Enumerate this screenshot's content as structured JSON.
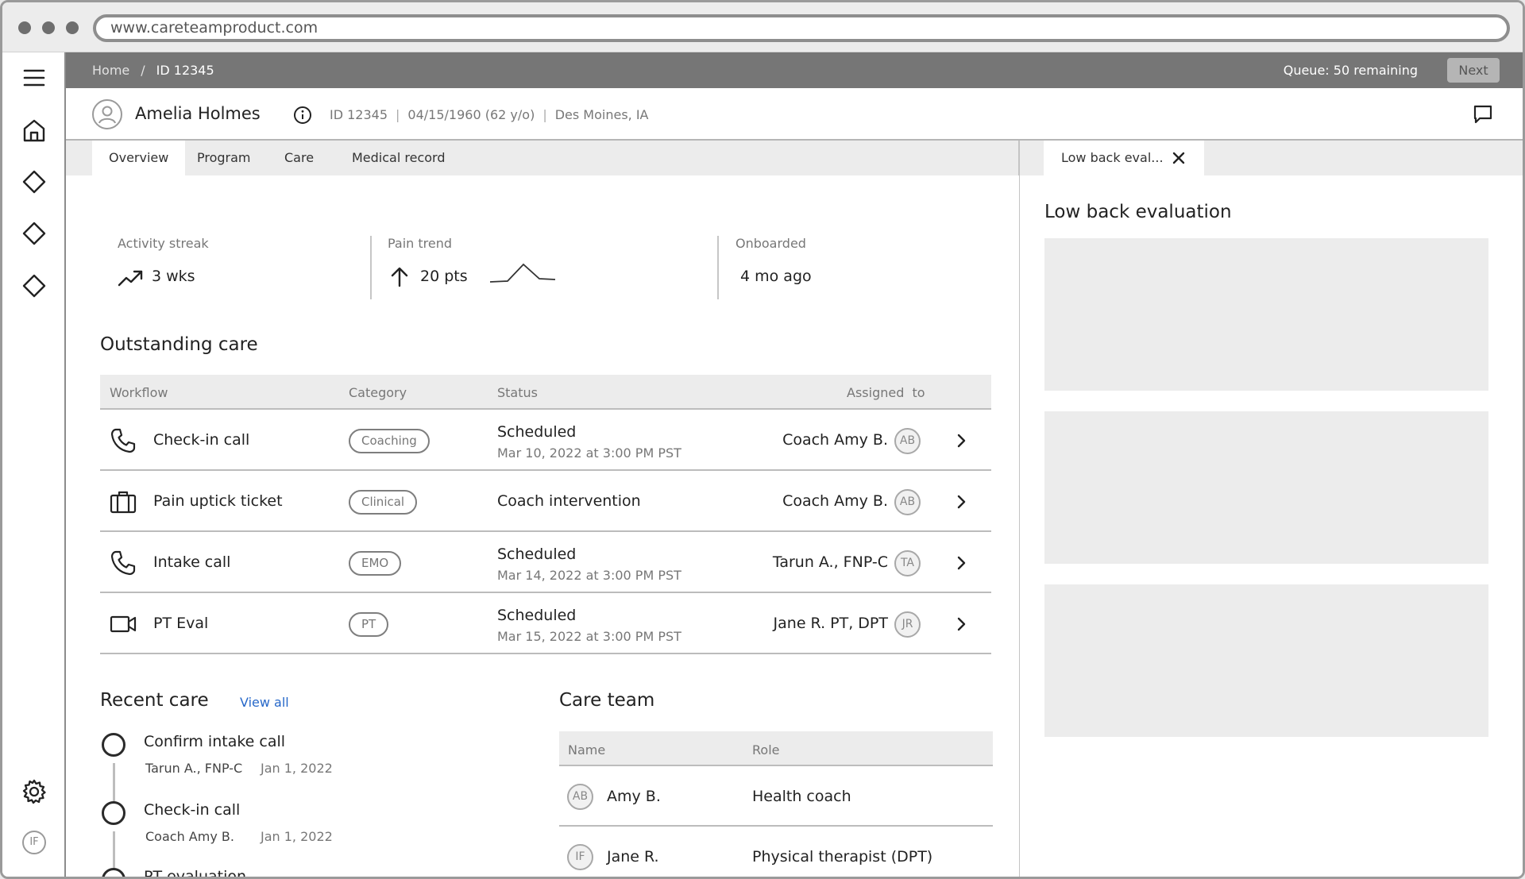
{
  "browser": {
    "url": "www.careteamproduct.com"
  },
  "topbar": {
    "breadcrumb_home": "Home",
    "breadcrumb_sep": "/",
    "breadcrumb_current": "ID 12345",
    "queue": "Queue: 50 remaining",
    "next_label": "Next"
  },
  "patient": {
    "name": "Amelia Holmes",
    "id": "ID 12345",
    "dob": "04/15/1960 (62 y/o)",
    "location": "Des Moines, IA",
    "sep": "|"
  },
  "tabs": [
    "Overview",
    "Program",
    "Care",
    "Medical record"
  ],
  "stats": {
    "activity_label": "Activity streak",
    "activity_value": "3 wks",
    "pain_label": "Pain trend",
    "pain_value": "20 pts",
    "onboarded_label": "Onboarded",
    "onboarded_value": "4 mo ago"
  },
  "outstanding": {
    "title": "Outstanding care",
    "headers": {
      "workflow": "Workflow",
      "category": "Category",
      "status": "Status",
      "assigned": "Assigned  to"
    },
    "rows": [
      {
        "icon": "phone-icon",
        "workflow": "Check-in call",
        "category": "Coaching",
        "status": "Scheduled",
        "date": "Mar 10, 2022 at 3:00 PM PST",
        "assignee": "Coach Amy B.",
        "initials": "AB"
      },
      {
        "icon": "briefcase-icon",
        "workflow": "Pain uptick ticket",
        "category": "Clinical",
        "status": "Coach intervention",
        "date": "",
        "assignee": "Coach Amy B.",
        "initials": "AB"
      },
      {
        "icon": "phone-icon",
        "workflow": "Intake call",
        "category": "EMO",
        "status": "Scheduled",
        "date": "Mar 14, 2022 at 3:00 PM PST",
        "assignee": "Tarun A., FNP-C",
        "initials": "TA"
      },
      {
        "icon": "video-icon",
        "workflow": "PT Eval",
        "category": "PT",
        "status": "Scheduled",
        "date": "Mar 15, 2022 at 3:00 PM PST",
        "assignee": "Jane R. PT, DPT",
        "initials": "JR"
      }
    ]
  },
  "recent": {
    "title": "Recent care",
    "view_all": "View all",
    "items": [
      {
        "title": "Confirm intake call",
        "who": "Tarun A., FNP-C",
        "when": "Jan 1, 2022"
      },
      {
        "title": "Check-in call",
        "who": "Coach Amy B.",
        "when": "Jan 1, 2022"
      },
      {
        "title": "PT evaluation",
        "who": "",
        "when": ""
      }
    ]
  },
  "careteam": {
    "title": "Care team",
    "headers": {
      "name": "Name",
      "role": "Role"
    },
    "members": [
      {
        "initials": "AB",
        "name": "Amy B.",
        "role": "Health coach"
      },
      {
        "initials": "IF",
        "name": "Jane R.",
        "role": "Physical therapist (DPT)"
      }
    ]
  },
  "right_panel": {
    "tab_label": "Low back eval...",
    "title": "Low back evaluation"
  },
  "user": {
    "initials": "IF"
  },
  "colors": {
    "link": "#2768c9",
    "topbar": "#767676"
  }
}
